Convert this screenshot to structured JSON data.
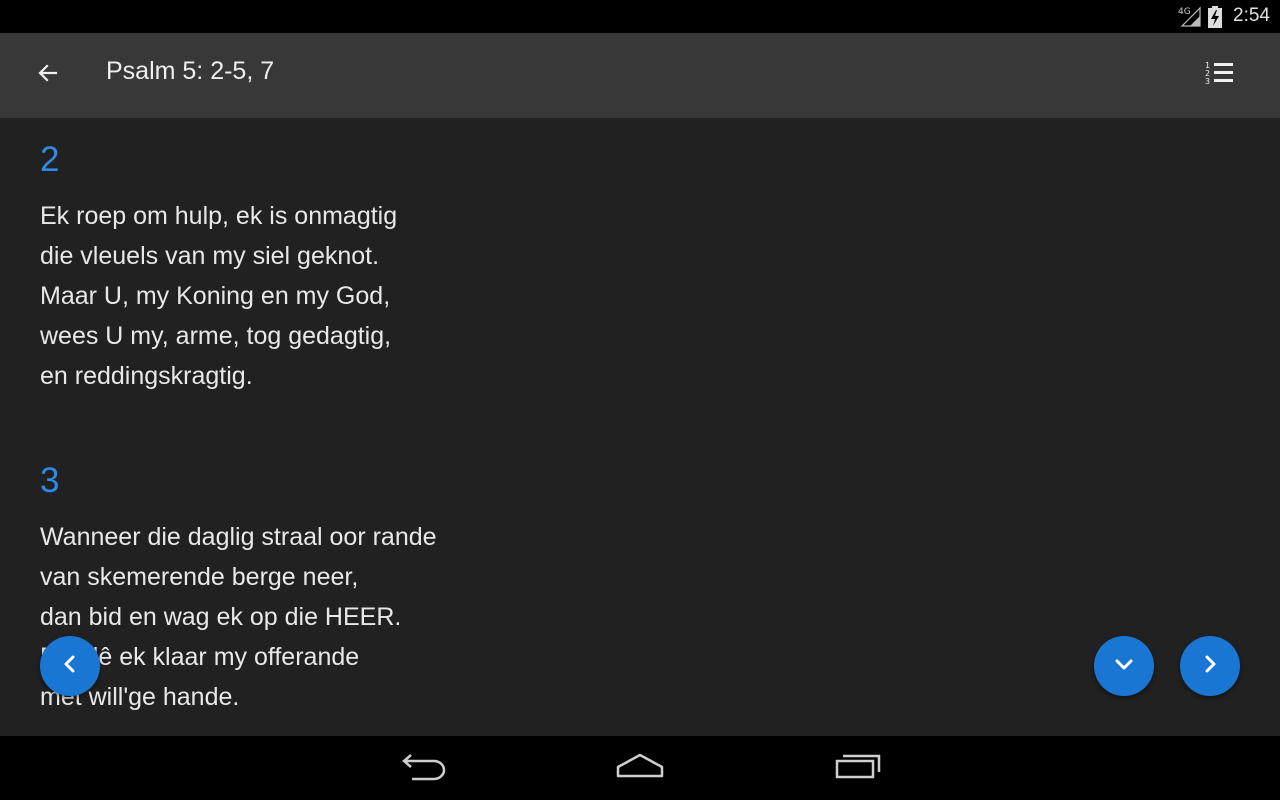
{
  "status_bar": {
    "network": "4G",
    "time": "2:54",
    "icons": [
      "signal-icon",
      "battery-charging-icon"
    ]
  },
  "app_bar": {
    "back_icon": "arrow-left-icon",
    "title": "Psalm 5: 2-5, 7",
    "list_icon": "numbered-list-icon"
  },
  "verses": [
    {
      "number": "2",
      "lines": [
        "Ek roep om hulp, ek is onmagtig",
        "die vleuels van my siel geknot.",
        "Maar U, my Koning en my God,",
        "wees U my, arme, tog gedagtig,",
        "en reddingskragtig."
      ]
    },
    {
      "number": "3",
      "lines": [
        "Wanneer die daglig straal oor rande",
        "van skemerende berge neer,",
        "dan bid en wag ek op die HEER.",
        "Dan lê ek klaar my offerande",
        "met will'ge hande."
      ]
    }
  ],
  "fabs": {
    "previous_icon": "chevron-left-icon",
    "down_icon": "chevron-down-icon",
    "next_icon": "chevron-right-icon"
  },
  "colors": {
    "accent": "#1976d2",
    "verse_number": "#2f8ae8",
    "app_bar": "#383838",
    "background": "#212121"
  },
  "nav_bar": {
    "icons": [
      "nav-back-icon",
      "nav-home-icon",
      "nav-recents-icon"
    ]
  }
}
